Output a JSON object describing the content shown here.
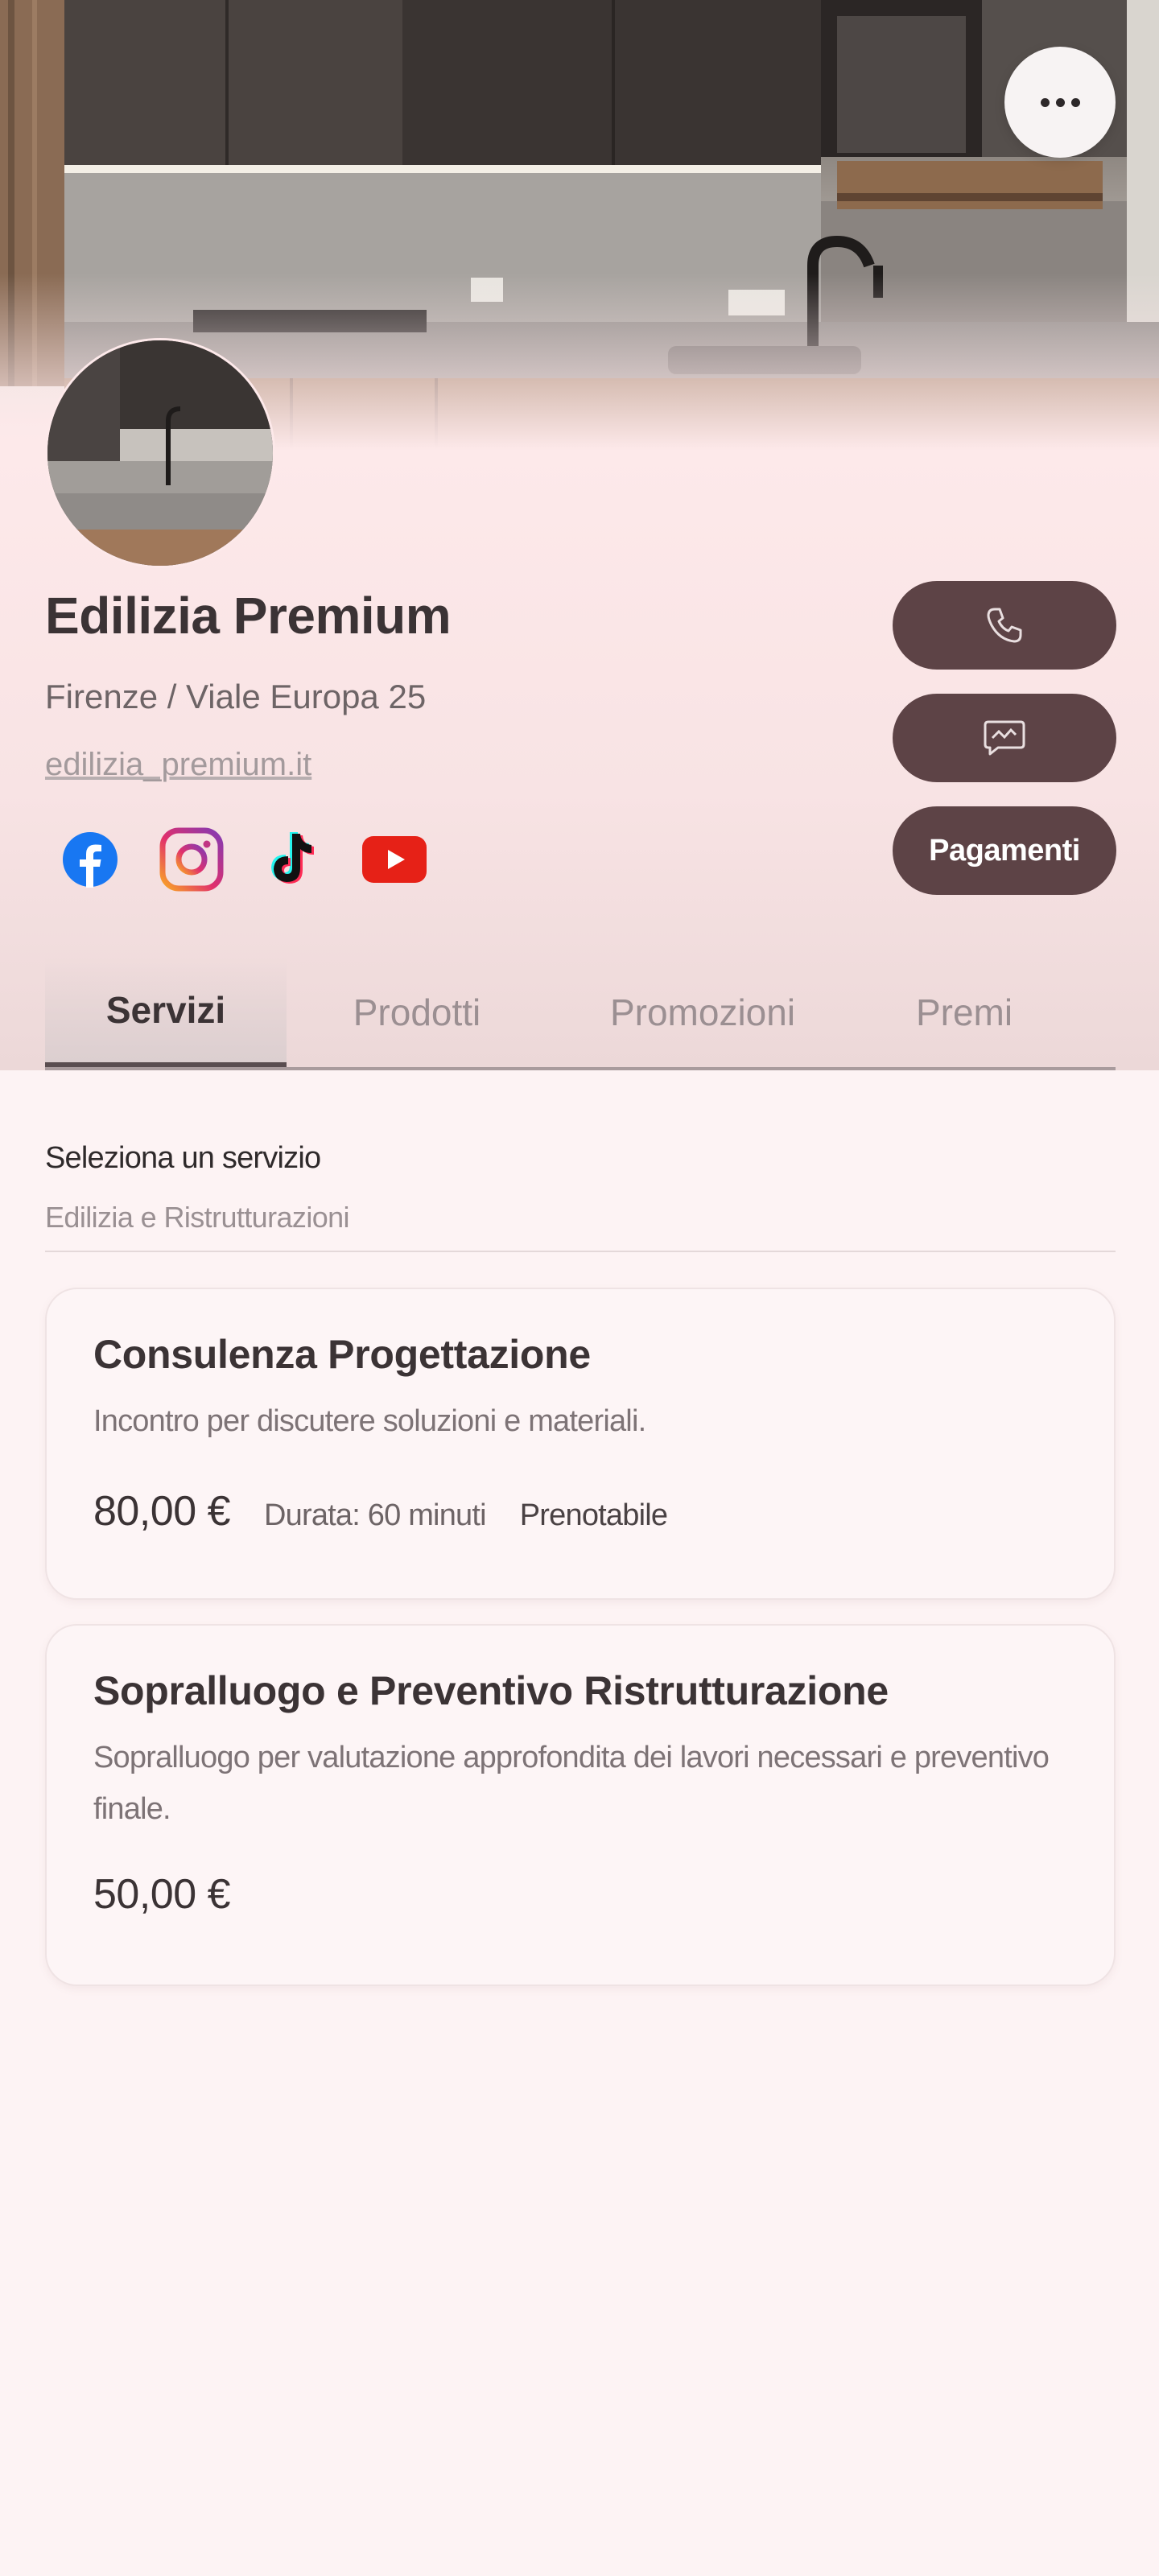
{
  "header": {
    "cover_description": "kitchen-photo",
    "more_icon": "ellipsis-icon"
  },
  "profile": {
    "name": "Edilizia Premium",
    "address": "Firenze / Viale Europa 25",
    "website": "edilizia_premium.it",
    "socials": [
      "facebook-icon",
      "instagram-icon",
      "tiktok-icon",
      "youtube-icon"
    ]
  },
  "actions": {
    "call_icon": "phone-icon",
    "message_icon": "chat-icon",
    "payments_label": "Pagamenti"
  },
  "tabs": [
    {
      "label": "Servizi",
      "active": true
    },
    {
      "label": "Prodotti",
      "active": false
    },
    {
      "label": "Promozioni",
      "active": false
    },
    {
      "label": "Premi",
      "active": false
    }
  ],
  "services": {
    "select_label": "Seleziona un servizio",
    "selected_category": "Edilizia e Ristrutturazioni",
    "items": [
      {
        "title": "Consulenza Progettazione",
        "description": "Incontro per discutere soluzioni e materiali.",
        "price": "80,00 €",
        "duration": "Durata: 60 minuti",
        "status": "Prenotabile"
      },
      {
        "title": "Sopralluogo e Preventivo Ristrutturazione",
        "description": "Sopralluogo per valutazione approfondita dei lavori necessari e preventivo finale.",
        "price": "50,00 €"
      }
    ]
  },
  "colors": {
    "background": "#fdf3f4",
    "accent": "#5d4346",
    "text": "#3b3335"
  }
}
